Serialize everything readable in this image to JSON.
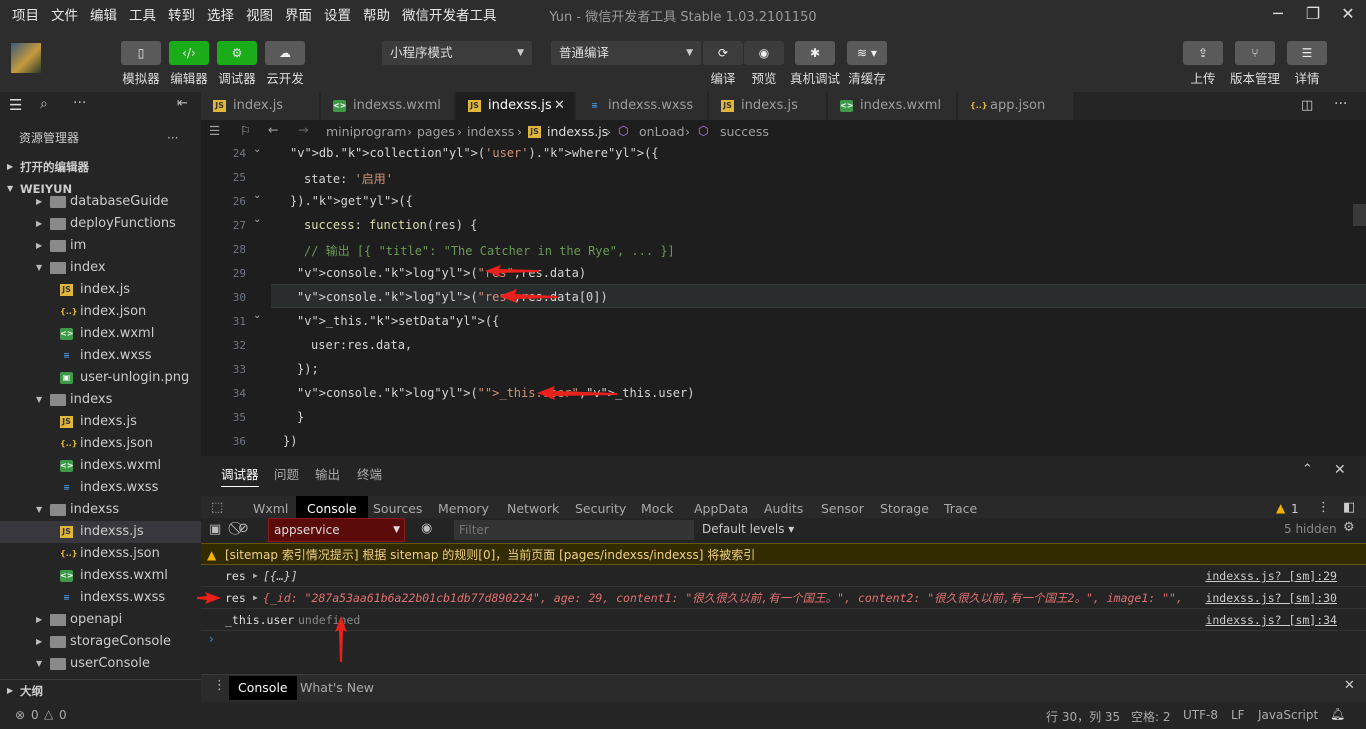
{
  "menu": [
    "项目",
    "文件",
    "编辑",
    "工具",
    "转到",
    "选择",
    "视图",
    "界面",
    "设置",
    "帮助",
    "微信开发者工具"
  ],
  "window_title": "Yun - 微信开发者工具 Stable 1.03.2101150",
  "toolbar": {
    "simulator": "模拟器",
    "editor": "编辑器",
    "debugger": "调试器",
    "cloud": "云开发",
    "mode_select": "小程序模式",
    "compile_select": "普通编译",
    "compile": "编译",
    "preview": "预览",
    "real_debug": "真机调试",
    "clear_cache": "清缓存",
    "upload": "上传",
    "version": "版本管理",
    "details": "详情"
  },
  "sidebar": {
    "title": "资源管理器",
    "open_editors": "打开的编辑器",
    "project": "WEIYUN",
    "outline": "大纲",
    "tree": [
      {
        "label": "databaseGuide",
        "type": "folder",
        "depth": 1,
        "open": false
      },
      {
        "label": "deployFunctions",
        "type": "folder",
        "depth": 1,
        "open": false
      },
      {
        "label": "im",
        "type": "folder",
        "depth": 1,
        "open": false
      },
      {
        "label": "index",
        "type": "folder",
        "depth": 1,
        "open": true
      },
      {
        "label": "index.js",
        "type": "js",
        "depth": 2
      },
      {
        "label": "index.json",
        "type": "json",
        "depth": 2
      },
      {
        "label": "index.wxml",
        "type": "wxml",
        "depth": 2
      },
      {
        "label": "index.wxss",
        "type": "wxss",
        "depth": 2
      },
      {
        "label": "user-unlogin.png",
        "type": "png",
        "depth": 2
      },
      {
        "label": "indexs",
        "type": "folder",
        "depth": 1,
        "open": true
      },
      {
        "label": "indexs.js",
        "type": "js",
        "depth": 2
      },
      {
        "label": "indexs.json",
        "type": "json",
        "depth": 2
      },
      {
        "label": "indexs.wxml",
        "type": "wxml",
        "depth": 2
      },
      {
        "label": "indexs.wxss",
        "type": "wxss",
        "depth": 2
      },
      {
        "label": "indexss",
        "type": "folder",
        "depth": 1,
        "open": true
      },
      {
        "label": "indexss.js",
        "type": "js",
        "depth": 2,
        "selected": true
      },
      {
        "label": "indexss.json",
        "type": "json",
        "depth": 2
      },
      {
        "label": "indexss.wxml",
        "type": "wxml",
        "depth": 2
      },
      {
        "label": "indexss.wxss",
        "type": "wxss",
        "depth": 2
      },
      {
        "label": "openapi",
        "type": "folder",
        "depth": 1,
        "open": false
      },
      {
        "label": "storageConsole",
        "type": "folder",
        "depth": 1,
        "open": false
      },
      {
        "label": "userConsole",
        "type": "folder",
        "depth": 1,
        "open": true
      }
    ]
  },
  "tabs": [
    {
      "label": "index.js",
      "type": "js"
    },
    {
      "label": "indexss.wxml",
      "type": "wxml"
    },
    {
      "label": "indexss.js",
      "type": "js",
      "active": true
    },
    {
      "label": "indexss.wxss",
      "type": "wxss"
    },
    {
      "label": "indexs.js",
      "type": "js"
    },
    {
      "label": "indexs.wxml",
      "type": "wxml"
    },
    {
      "label": "app.json",
      "type": "json"
    }
  ],
  "breadcrumb": [
    "miniprogram",
    "pages",
    "indexss",
    "indexss.js",
    "onLoad",
    "success"
  ],
  "line_numbers": [
    "24",
    "25",
    "26",
    "27",
    "28",
    "29",
    "30",
    "31",
    "32",
    "33",
    "34",
    "35",
    "36"
  ],
  "code": {
    "l24": "db.collection('user').where({",
    "l25a": "state: ",
    "l25b": "'启用'",
    "l26": "}).get({",
    "l27a": "success",
    "l27b": ": ",
    "l27c": "function",
    "l27d": "(res) {",
    "l28": "// 输出 [{ \"title\": \"The Catcher in the Rye\", ... }]",
    "l29": "console.log(\"res\",res.data)",
    "l30": "console.log(\"res\",res.data[0])",
    "l31": "_this.setData({",
    "l32": "user:res.data,",
    "l33": "});",
    "l34": "console.log(\"_this.user\",_this.user)",
    "l35": "}",
    "l36": "})"
  },
  "panel": {
    "tabs": [
      "调试器",
      "问题",
      "输出",
      "终端"
    ],
    "devtools_tabs": [
      "Wxml",
      "Console",
      "Sources",
      "Memory",
      "Network",
      "Security",
      "Mock",
      "AppData",
      "Audits",
      "Sensor",
      "Storage",
      "Trace"
    ],
    "warn_count": "1",
    "context": "appservice",
    "filter_placeholder": "Filter",
    "levels": "Default levels",
    "hidden": "5 hidden",
    "sitemap_msg": "[sitemap 索引情况提示] 根据 sitemap 的规则[0]，当前页面 [pages/indexss/indexss] 将被索引",
    "logs": [
      {
        "label": "res",
        "value": "[{…}]",
        "src": "indexss.js? [sm]:29"
      },
      {
        "label": "res",
        "value": "{_id: \"287a53aa61b6a22b01cb1db77d890224\", age: 29, content1: \"很久很久以前,有一个国王。\", content2: \"很久很久以前,有一个国王2。\", image1: \"\", …}",
        "src": "indexss.js? [sm]:30"
      },
      {
        "label": "_this.user",
        "value": "undefined",
        "src": "indexss.js? [sm]:34"
      }
    ],
    "bottom_tabs": [
      "Console",
      "What's New"
    ]
  },
  "status": {
    "errors": "0",
    "warnings": "0",
    "position": "行 30，列 35",
    "spaces": "空格: 2",
    "encoding": "UTF-8",
    "eol": "LF",
    "language": "JavaScript"
  }
}
